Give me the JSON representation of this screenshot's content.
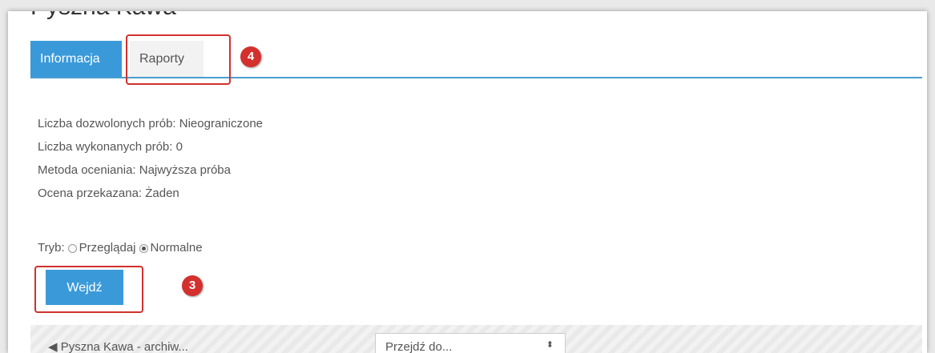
{
  "page": {
    "title": "Pyszna Kawa"
  },
  "tabs": [
    {
      "label": "Informacja",
      "active": true
    },
    {
      "label": "Raporty",
      "active": false
    }
  ],
  "info": [
    "Liczba dozwolonych prób: Nieograniczone",
    "Liczba wykonanych prób: 0",
    "Metoda oceniania: Najwyższa próba",
    "Ocena przekazana: Żaden"
  ],
  "mode": {
    "label": "Tryb:",
    "options": [
      {
        "label": "Przeglądaj",
        "selected": false
      },
      {
        "label": "Normalne",
        "selected": true
      }
    ]
  },
  "enter_button": {
    "label": "Wejdź"
  },
  "annotations": {
    "tab_marker": "4",
    "button_marker": "3",
    "color": "#d3302e"
  },
  "nav": {
    "prev_link": "◀ Pyszna Kawa - archiw...",
    "jump_select": "Przejdź do...",
    "jump_arrow": "⬍"
  },
  "colors": {
    "accent": "#3a9ad9",
    "highlight": "#d0312d"
  }
}
